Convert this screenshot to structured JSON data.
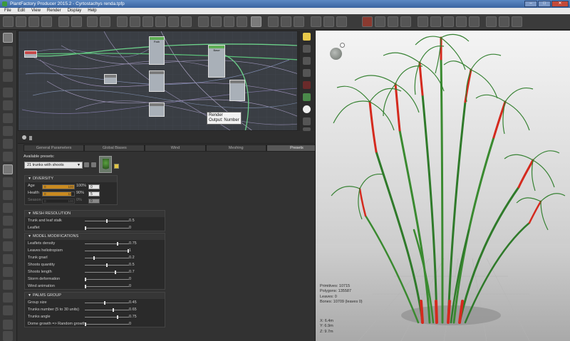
{
  "window": {
    "title": "PlantFactory Producer 2015.2 - Cyrtostachys renda.tpfp",
    "minimize": "–",
    "maximize": "□",
    "close": "✕"
  },
  "menu": [
    "File",
    "Edit",
    "View",
    "Render",
    "Display",
    "Help"
  ],
  "graph": {
    "node1": "Path",
    "node2": "Base",
    "tooltip_line1": "Render",
    "tooltip_line2": "Output: Number"
  },
  "tabs": [
    {
      "label": "General Parameters",
      "active": false
    },
    {
      "label": "Global Biases",
      "active": false
    },
    {
      "label": "Wind",
      "active": false
    },
    {
      "label": "Meshing",
      "active": false
    },
    {
      "label": "Presets",
      "active": true
    }
  ],
  "presets": {
    "label": "Available presets:",
    "selected": "21 trunks with shoots"
  },
  "diversity": {
    "title": "DIVERSITY",
    "age": {
      "label": "Age",
      "min": "0",
      "max": "100",
      "percent": "100%",
      "spin": "0",
      "fill": 1.0
    },
    "health": {
      "label": "Health",
      "min": "0",
      "max": "100",
      "percent": "90%",
      "spin": "5",
      "fill": 0.9
    },
    "season": {
      "label": "Season",
      "min": "0",
      "max": "100",
      "percent": "0%",
      "spin": "0",
      "fill": 0.0
    }
  },
  "mesh_resolution": {
    "title": "MESH RESOLUTION",
    "rows": [
      {
        "label": "Trunk and leaf stalk",
        "value": "0.5",
        "pos": 0.5
      },
      {
        "label": "Leaflet",
        "value": "0",
        "pos": 0.0
      }
    ]
  },
  "model_modifications": {
    "title": "MODEL MODIFICATIONS",
    "rows": [
      {
        "label": "Leaflets density",
        "value": "0.75",
        "pos": 0.75
      },
      {
        "label": "Leaves heliotropism",
        "value": "1",
        "pos": 1.0
      },
      {
        "label": "Trunk gnarl",
        "value": "0.2",
        "pos": 0.2
      },
      {
        "label": "Shoots quantity",
        "value": "0.5",
        "pos": 0.5
      },
      {
        "label": "Shoots length",
        "value": "0.7",
        "pos": 0.7
      },
      {
        "label": "Storm deformation",
        "value": "0",
        "pos": 0.0
      },
      {
        "label": "Wind animation",
        "value": "0",
        "pos": 0.0
      }
    ]
  },
  "palms_group": {
    "title": "PALMS GROUP",
    "rows": [
      {
        "label": "Group size",
        "value": "0.45",
        "pos": 0.45
      },
      {
        "label": "Trunks number (5 to 30 units)",
        "value": "0.65",
        "pos": 0.65
      },
      {
        "label": "Trunks angle",
        "value": "0.75",
        "pos": 0.75
      },
      {
        "label": "Dome growth => Random growth",
        "value": "0",
        "pos": 0.0
      }
    ]
  },
  "stats": {
    "primitives": "Primitives: 10715",
    "polygons": "Polygons: 135587",
    "leaves": "Leaves: 0",
    "bones": "Bones: 10709 (leaves 0)",
    "x": "X: 6.4m",
    "y": "Y: 6.9m",
    "z": "Z: 9.7m"
  },
  "colors": {
    "trunk_red": "#d42a1e",
    "leaf_green": "#2f7a2a",
    "accent_orange": "#c98a20"
  }
}
